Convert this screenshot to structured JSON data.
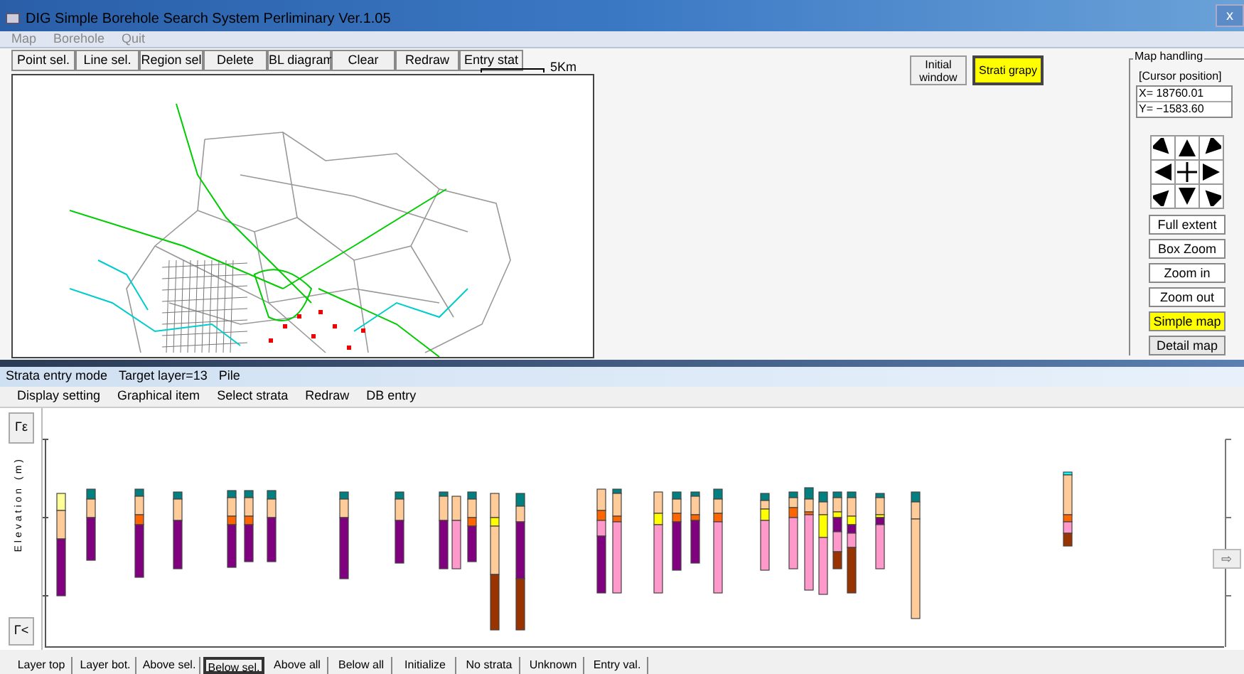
{
  "window": {
    "title": "DIG Simple Borehole Search System Perliminary Ver.1.05",
    "close": "x"
  },
  "menu": [
    "Map",
    "Borehole",
    "Quit"
  ],
  "toolbar": [
    "Point sel.",
    "Line sel.",
    "Region sel",
    "Delete",
    "BL diagram",
    "Clear",
    "Redraw",
    "Entry stat"
  ],
  "scale_bar": {
    "label": "5Km"
  },
  "view_buttons": [
    {
      "label": "Initial window",
      "selected": false
    },
    {
      "label": "Strati grapy",
      "selected": true
    }
  ],
  "map_handling": {
    "title": "Map handling",
    "cursor_label": "[Cursor position]",
    "x": "X= 18760.01",
    "y": "Y= −1583.60",
    "buttons": [
      {
        "label": "Full extent",
        "kind": "action",
        "selected": false
      },
      {
        "label": "Box Zoom",
        "kind": "action",
        "selected": false
      },
      {
        "label": "Zoom in",
        "kind": "action",
        "selected": false
      },
      {
        "label": "Zoom out",
        "kind": "action",
        "selected": false
      },
      {
        "label": "Simple map",
        "kind": "toggle",
        "selected": true
      },
      {
        "label": "Detail map",
        "kind": "toggle",
        "selected": false
      }
    ]
  },
  "strata_window": {
    "status": [
      "Strata entry mode",
      "Target layer=13",
      "Pile"
    ],
    "menu": [
      "Display setting",
      "Graphical item",
      "Select strata",
      "Redraw",
      "DB entry"
    ],
    "nav_top": "Γε",
    "nav_bottom": "Γ<",
    "axis_label": "Elevation (m)",
    "next": "⇨",
    "buttons": [
      {
        "label": "Layer top",
        "selected": false
      },
      {
        "label": "Layer bot.",
        "selected": false
      },
      {
        "label": "Above sel.",
        "selected": false
      },
      {
        "label": "Below sel.",
        "selected": true
      },
      {
        "label": "Above all",
        "selected": false
      },
      {
        "label": "Below all",
        "selected": false
      },
      {
        "label": "Initialize",
        "selected": false
      },
      {
        "label": "No strata",
        "selected": false
      },
      {
        "label": "Unknown",
        "selected": false
      },
      {
        "label": "Entry val.",
        "selected": false
      }
    ]
  }
}
